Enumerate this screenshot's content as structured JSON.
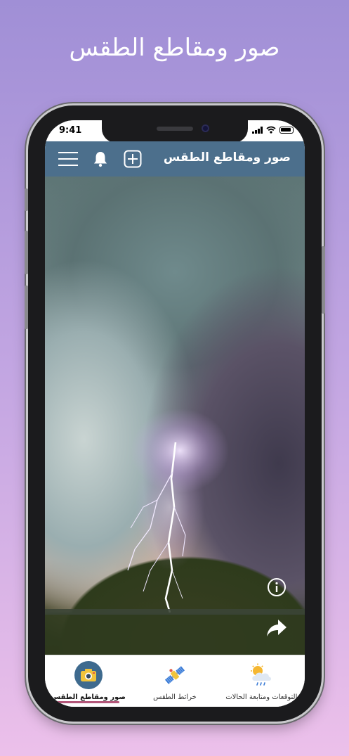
{
  "promo": {
    "title": "صور ومقاطع الطقس"
  },
  "status_bar": {
    "time": "9:41",
    "icons": [
      "signal-icon",
      "wifi-icon",
      "battery-icon"
    ]
  },
  "header": {
    "title": "صور ومقاطع الطقس",
    "background": "#4c6f8c",
    "icons": [
      "menu-icon",
      "bell-icon",
      "add-icon"
    ]
  },
  "content": {
    "image": "storm-lightning-photo",
    "actions": [
      "info-icon",
      "share-icon"
    ]
  },
  "bottom_nav": {
    "items": [
      {
        "label": "صور ومقاطع الطقس",
        "icon": "camera-icon",
        "active": true
      },
      {
        "label": "خرائط الطقس",
        "icon": "satellite-icon",
        "active": false
      },
      {
        "label": "التوقعات ومتابعة الحالات",
        "icon": "weather-cloud-rain-icon",
        "active": false
      }
    ],
    "active_color": "#b3577a"
  }
}
